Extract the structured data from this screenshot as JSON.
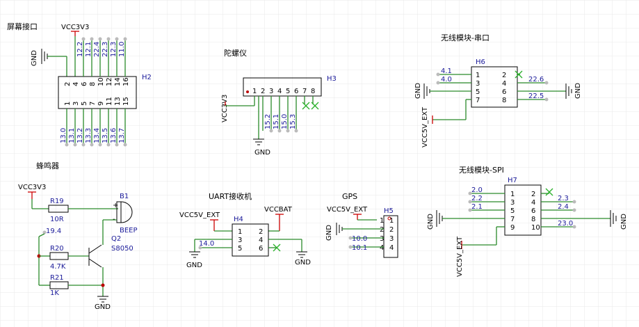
{
  "sections": {
    "screen": "屏幕接口",
    "gyro": "陀螺仪",
    "wireless_uart": "无线模块-串口",
    "buzzer": "蜂鸣器",
    "uart_rx": "UART接收机",
    "gps": "GPS",
    "wireless_spi": "无线模块-SPI"
  },
  "power": {
    "vcc3v3": "VCC3V3",
    "vcc5v_ext": "VCC5V_EXT",
    "vccbat": "VCCBAT",
    "gnd": "GND"
  },
  "refs": {
    "h2": "H2",
    "h3": "H3",
    "h4": "H4",
    "h5": "H5",
    "h6": "H6",
    "h7": "H7",
    "b1": "B1",
    "q2": "Q2",
    "r19": "R19",
    "r20": "R20",
    "r21": "R21"
  },
  "values": {
    "r19": "10R",
    "r20": "4.7K",
    "r21": "1K",
    "b1": "BEEP",
    "q2": "S8050"
  },
  "h2": {
    "top_pins": [
      "2",
      "4",
      "6",
      "8",
      "10",
      "12",
      "14",
      "16"
    ],
    "bottom_pins": [
      "1",
      "3",
      "5",
      "7",
      "9",
      "11",
      "13",
      "15"
    ],
    "top_nets": [
      "12.2",
      "12.1",
      "22.4",
      "22.3",
      "12.3",
      "11.0"
    ],
    "bottom_nets": [
      "13.0",
      "13.1",
      "13.2",
      "13.3",
      "13.4",
      "13.5",
      "13.6",
      "13.7"
    ]
  },
  "h3": {
    "pins": [
      "1",
      "2",
      "3",
      "4",
      "5",
      "6",
      "7",
      "8"
    ],
    "nets": [
      "15.2",
      "15.1",
      "15.0",
      "15.3"
    ]
  },
  "h6": {
    "left_pins": [
      "1",
      "3",
      "5",
      "7"
    ],
    "right_pins": [
      "2",
      "4",
      "6",
      "8"
    ],
    "left_nets": [
      "4.1",
      "4.0"
    ],
    "right_nets": [
      "22.6",
      "22.5"
    ]
  },
  "h7": {
    "left_pins": [
      "1",
      "3",
      "5",
      "7",
      "9"
    ],
    "right_pins": [
      "2",
      "4",
      "6",
      "8",
      "10"
    ],
    "left_nets": [
      "2.0",
      "2.2",
      "2.1"
    ],
    "right_nets": [
      "2.3",
      "2.4",
      "23.0"
    ]
  },
  "h4": {
    "left_pins": [
      "1",
      "3",
      "5"
    ],
    "right_pins": [
      "2",
      "4",
      "6"
    ],
    "net": "14.0"
  },
  "h5": {
    "pins": [
      "1",
      "2",
      "3",
      "4"
    ],
    "nets": [
      "10.0",
      "10.1"
    ]
  },
  "buzzer_net": "19.4",
  "colors": {
    "wire": "#2a8a2a",
    "power": "#c00000",
    "label": "#1a1a99",
    "grid": "#e6e6e6"
  }
}
